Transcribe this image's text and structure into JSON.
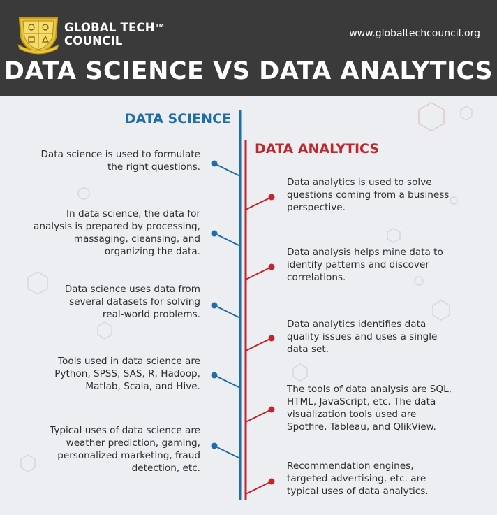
{
  "header": {
    "org_line1": "GLOBAL TECH",
    "org_tm": "TM",
    "org_line2": "COUNCIL",
    "website": "www.globaltechcouncil.org",
    "title": "DATA SCIENCE VS DATA ANALYTICS"
  },
  "colors": {
    "header_bg": "#3a3a3b",
    "data_science": "#1f6ea8",
    "data_analytics": "#c0272d",
    "logo_gold": "#e8c53a"
  },
  "data_science": {
    "title": "DATA SCIENCE",
    "items": [
      [
        "Data science is used to formulate",
        "the right questions."
      ],
      [
        "In data science, the data for",
        "analysis is prepared by processing,",
        "massaging, cleansing, and",
        "organizing the data."
      ],
      [
        "Data science uses data from",
        "several datasets for solving",
        "real-world problems."
      ],
      [
        "Tools used in data science are",
        "Python, SPSS, SAS, R, Hadoop,",
        "Matlab, Scala, and Hive."
      ],
      [
        "Typical uses of data science are",
        "weather prediction, gaming,",
        "personalized marketing, fraud",
        "detection, etc."
      ]
    ]
  },
  "data_analytics": {
    "title": "DATA ANALYTICS",
    "items": [
      [
        "Data analytics is used to solve",
        "questions coming from a business",
        "perspective."
      ],
      [
        "Data analysis helps mine data to",
        "identify patterns and discover",
        "correlations."
      ],
      [
        "Data analytics identifies data",
        "quality issues and uses a single",
        "data set."
      ],
      [
        "The tools of data analysis are SQL,",
        "HTML, JavaScript, etc. The data",
        "visualization tools used are",
        "Spotfire, Tableau, and QlikView."
      ],
      [
        "Recommendation engines,",
        "targeted advertising, etc. are",
        "typical uses of data analytics."
      ]
    ]
  }
}
